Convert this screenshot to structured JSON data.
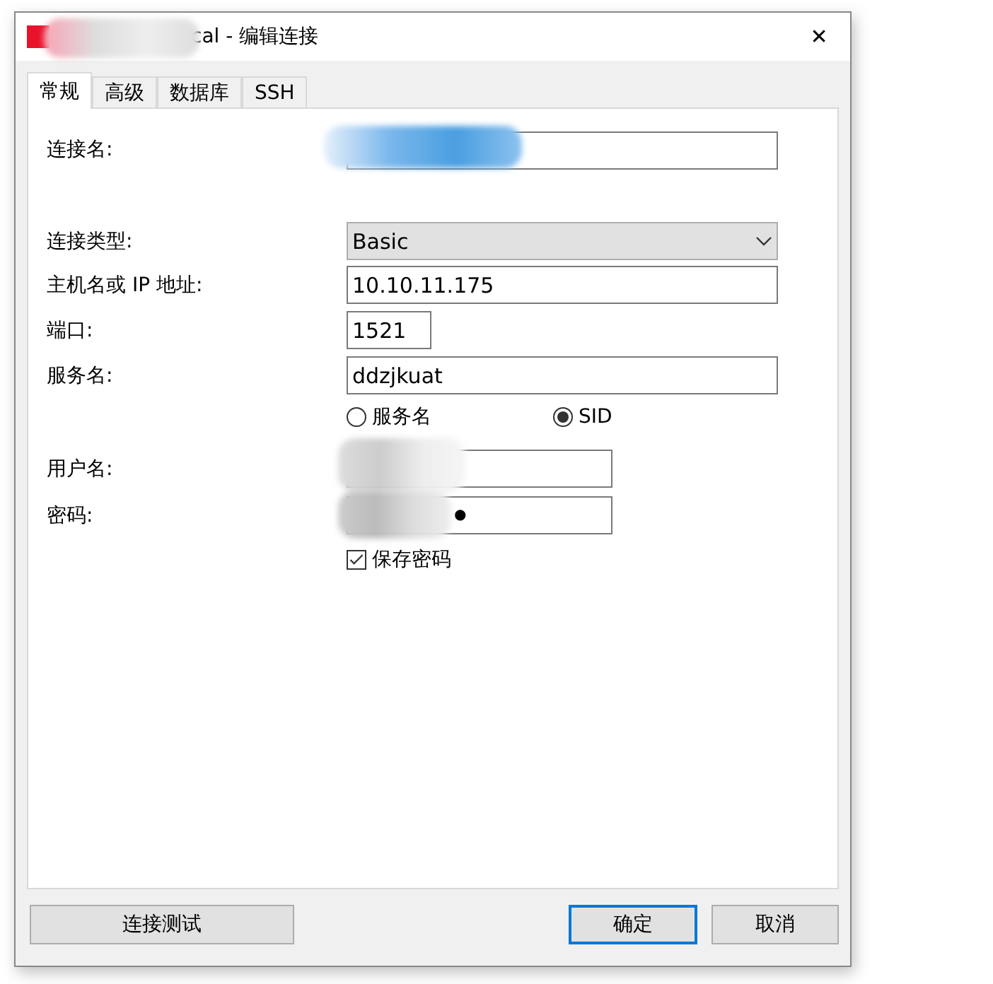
{
  "window": {
    "title": "cal - 编辑连接",
    "close": "✕"
  },
  "tabs": [
    {
      "label": "常规",
      "selected": true
    },
    {
      "label": "高级",
      "selected": false
    },
    {
      "label": "数据库",
      "selected": false
    },
    {
      "label": "SSH",
      "selected": false
    }
  ],
  "form": {
    "connection_name": {
      "label": "连接名:"
    },
    "connection_type": {
      "label": "连接类型:",
      "value": "Basic"
    },
    "host": {
      "label": "主机名或 IP 地址:",
      "value": "10.10.11.175"
    },
    "port": {
      "label": "端口:",
      "value": "1521"
    },
    "service_name": {
      "label": "服务名:",
      "value": "ddzjkuat"
    },
    "service_type": [
      {
        "label": "服务名",
        "selected": false
      },
      {
        "label": "SID",
        "selected": true
      }
    ],
    "username": {
      "label": "用户名:"
    },
    "password": {
      "label": "密码:",
      "value": "●"
    },
    "save_password": {
      "label": "保存密码",
      "checked": true
    }
  },
  "buttons": {
    "test": "连接测试",
    "ok": "确定",
    "cancel": "取消"
  }
}
